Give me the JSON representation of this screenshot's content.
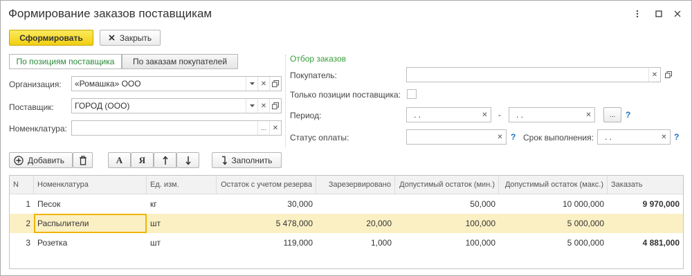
{
  "window": {
    "title": "Формирование заказов поставщикам"
  },
  "toolbar": {
    "form_label": "Сформировать",
    "close_label": "Закрыть"
  },
  "tabs": [
    {
      "label": "По позициям поставщика",
      "active": true
    },
    {
      "label": "По заказам покупателей",
      "active": false
    }
  ],
  "left_form": {
    "organization_label": "Организация:",
    "organization_value": "«Ромашка» ООО",
    "supplier_label": "Поставщик:",
    "supplier_value": "ГОРОД (ООО)",
    "nomenclature_label": "Номенклатура:",
    "nomenclature_value": ""
  },
  "filter": {
    "title": "Отбор заказов",
    "buyer_label": "Покупатель:",
    "buyer_value": "",
    "only_supplier_label": "Только позиции поставщика:",
    "period_label": "Период:",
    "period_from": ".  .",
    "period_dash": "-",
    "period_to": ".  .",
    "period_btn": "...",
    "payment_status_label": "Статус оплаты:",
    "payment_status_value": "",
    "deadline_label": "Срок выполнения:",
    "deadline_value": ".  .",
    "help": "?"
  },
  "table_toolbar": {
    "add_label": "Добавить",
    "sort_asc_label": "А",
    "sort_desc_label": "Я",
    "fill_label": "Заполнить"
  },
  "table": {
    "columns": [
      "N",
      "Номенклатура",
      "Ед. изм.",
      "Остаток с учетом резерва",
      "Зарезервировано",
      "Допустимый остаток (мин.)",
      "Допустимый остаток (макс.)",
      "Заказать"
    ],
    "rows": [
      {
        "n": "1",
        "name": "Песок",
        "unit": "кг",
        "stock": "30,000",
        "reserved": "",
        "min": "50,000",
        "max": "10 000,000",
        "order": "9 970,000"
      },
      {
        "n": "2",
        "name": "Распылители",
        "unit": "шт",
        "stock": "5 478,000",
        "reserved": "20,000",
        "min": "100,000",
        "max": "5 000,000",
        "order": ""
      },
      {
        "n": "3",
        "name": "Розетка",
        "unit": "шт",
        "stock": "119,000",
        "reserved": "1,000",
        "min": "100,000",
        "max": "5 000,000",
        "order": "4 881,000"
      }
    ]
  },
  "icons": {
    "more": "more-vert-icon",
    "maximize": "maximize-icon",
    "close": "close-icon"
  }
}
